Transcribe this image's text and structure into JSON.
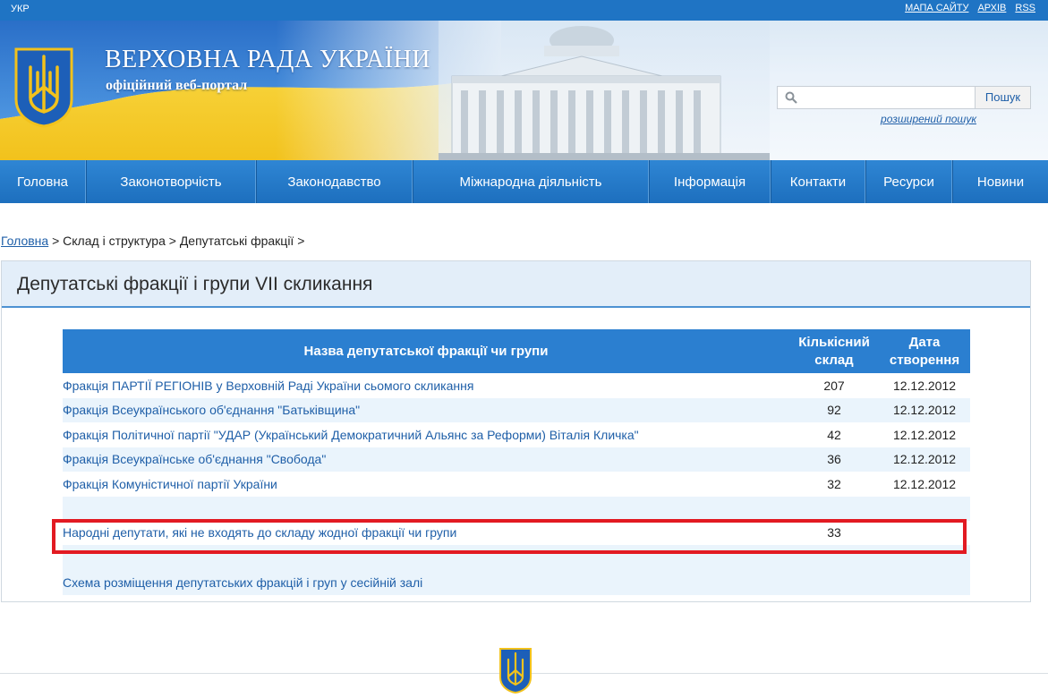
{
  "topbar": {
    "lang": "УКР",
    "links": [
      "МАПА САЙТУ",
      "АРХІВ",
      "RSS"
    ]
  },
  "header": {
    "title": "ВЕРХОВНА РАДА УКРАЇНИ",
    "subtitle": "офіційний веб-портал"
  },
  "search": {
    "placeholder": "",
    "button": "Пошук",
    "advanced": "розширений пошук"
  },
  "nav": {
    "items": [
      "Головна",
      "Законотворчість",
      "Законодавство",
      "Міжнародна діяльність",
      "Інформація",
      "Контакти",
      "Ресурси",
      "Новини"
    ]
  },
  "breadcrumb": {
    "home": "Головна",
    "rest": " > Склад і структура > Депутатські фракції >"
  },
  "page": {
    "title": "Депутатські фракції і групи VII скликання"
  },
  "table": {
    "headers": [
      "Назва депутатської фракції чи групи",
      "Кількісний склад",
      "Дата створення"
    ],
    "rows": [
      {
        "name": "Фракція ПАРТІЇ РЕГІОНІВ у Верховній Раді України сьомого скликання",
        "count": "207",
        "date": "12.12.2012"
      },
      {
        "name": "Фракція Всеукраїнського об'єднання \"Батьківщина\"",
        "count": "92",
        "date": "12.12.2012"
      },
      {
        "name": "Фракція Політичної партії \"УДАР (Український Демократичний Альянс за Реформи) Віталія Кличка\"",
        "count": "42",
        "date": "12.12.2012"
      },
      {
        "name": "Фракція Всеукраїнське об'єднання \"Свобода\"",
        "count": "36",
        "date": "12.12.2012"
      },
      {
        "name": "Фракція Комуністичної партії України",
        "count": "32",
        "date": "12.12.2012"
      }
    ],
    "nonaffiliated": {
      "name": "Народні депутати, які не входять до складу жодної фракції чи групи",
      "count": "33"
    },
    "scheme_link": "Схема розміщення депутатських фракцій і груп у сесійній залі"
  },
  "colors": {
    "nav_blue": "#1f74c4",
    "header_blue": "#2b7fd0",
    "highlight_red": "#e21a22",
    "link_blue": "#1f5fa8"
  }
}
